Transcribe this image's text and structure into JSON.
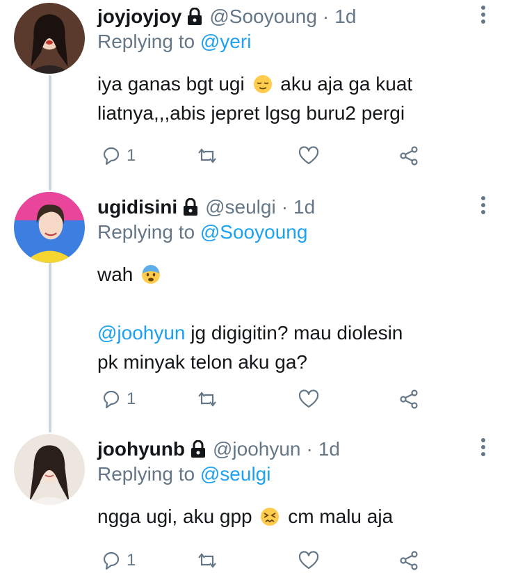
{
  "tweets": [
    {
      "username": "joyjoyjoy",
      "handle": "@Sooyoung",
      "time": "1d",
      "replying_prefix": "Replying to",
      "replying_to": "@yeri",
      "body": {
        "line1_before": "iya ganas bgt ugi",
        "line1_after": "aku aja ga kuat",
        "line2": "liatnya,,,abis jepret lgsg buru2 pergi"
      },
      "reply_count": "1",
      "emoji": "relieved-face-icon"
    },
    {
      "username": "ugidisini",
      "handle": "@seulgi",
      "time": "1d",
      "replying_prefix": "Replying to",
      "replying_to": "@Sooyoung",
      "body": {
        "p1": "wah",
        "mention": "@joohyun",
        "p2_after_mention": " jg digigitin? mau diolesin",
        "p3": "pk minyak telon aku ga?"
      },
      "reply_count": "1",
      "emoji": "fearful-face-icon"
    },
    {
      "username": "joohyunb",
      "handle": "@joohyun",
      "time": "1d",
      "replying_prefix": "Replying to",
      "replying_to": "@seulgi",
      "body": {
        "before": "ngga ugi, aku gpp",
        "after": "cm malu aja"
      },
      "reply_count": "1",
      "emoji": "confounded-face-icon"
    }
  ],
  "separator": "·",
  "colors": {
    "text": "#14171a",
    "secondary": "#657786",
    "link": "#1da1f2",
    "thread_line": "#ccd6dd"
  }
}
